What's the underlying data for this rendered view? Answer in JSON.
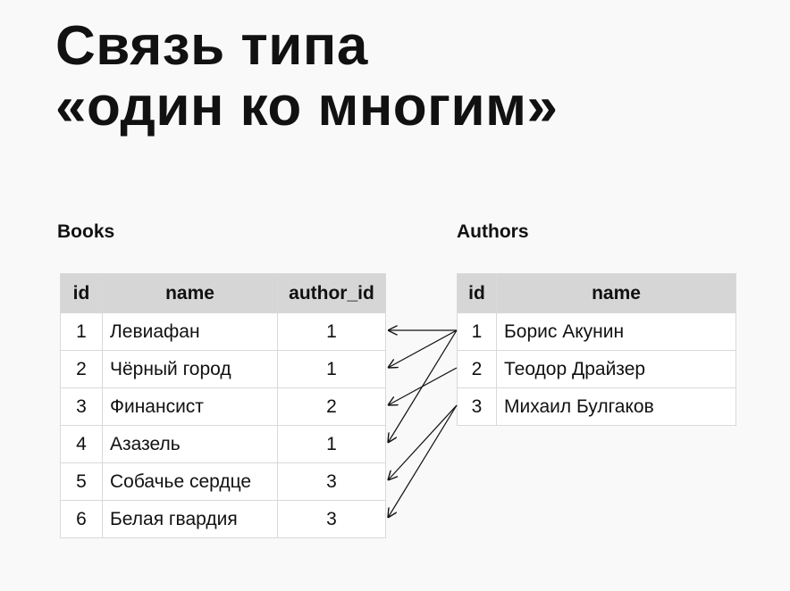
{
  "title": {
    "line1": "Связь типа",
    "line2": "«один ко многим»"
  },
  "books": {
    "label": "Books",
    "columns": [
      "id",
      "name",
      "author_id"
    ],
    "rows": [
      {
        "id": "1",
        "name": "Левиафан",
        "author_id": "1"
      },
      {
        "id": "2",
        "name": "Чёрный город",
        "author_id": "1"
      },
      {
        "id": "3",
        "name": "Финансист",
        "author_id": "2"
      },
      {
        "id": "4",
        "name": "Азазель",
        "author_id": "1"
      },
      {
        "id": "5",
        "name": "Собачье сердце",
        "author_id": "3"
      },
      {
        "id": "6",
        "name": "Белая гвардия",
        "author_id": "3"
      }
    ]
  },
  "authors": {
    "label": "Authors",
    "columns": [
      "id",
      "name"
    ],
    "rows": [
      {
        "id": "1",
        "name": "Борис Акунин"
      },
      {
        "id": "2",
        "name": "Теодор Драйзер"
      },
      {
        "id": "3",
        "name": "Михаил Булгаков"
      }
    ]
  },
  "relations": [
    {
      "author_row": 1,
      "book_row": 1
    },
    {
      "author_row": 1,
      "book_row": 2
    },
    {
      "author_row": 1,
      "book_row": 4
    },
    {
      "author_row": 2,
      "book_row": 3
    },
    {
      "author_row": 3,
      "book_row": 5
    },
    {
      "author_row": 3,
      "book_row": 6
    }
  ],
  "colors": {
    "header_bg": "#d6d6d6",
    "grid": "#d9d9d9",
    "page_bg": "#f9f9f9",
    "text": "#111111"
  }
}
